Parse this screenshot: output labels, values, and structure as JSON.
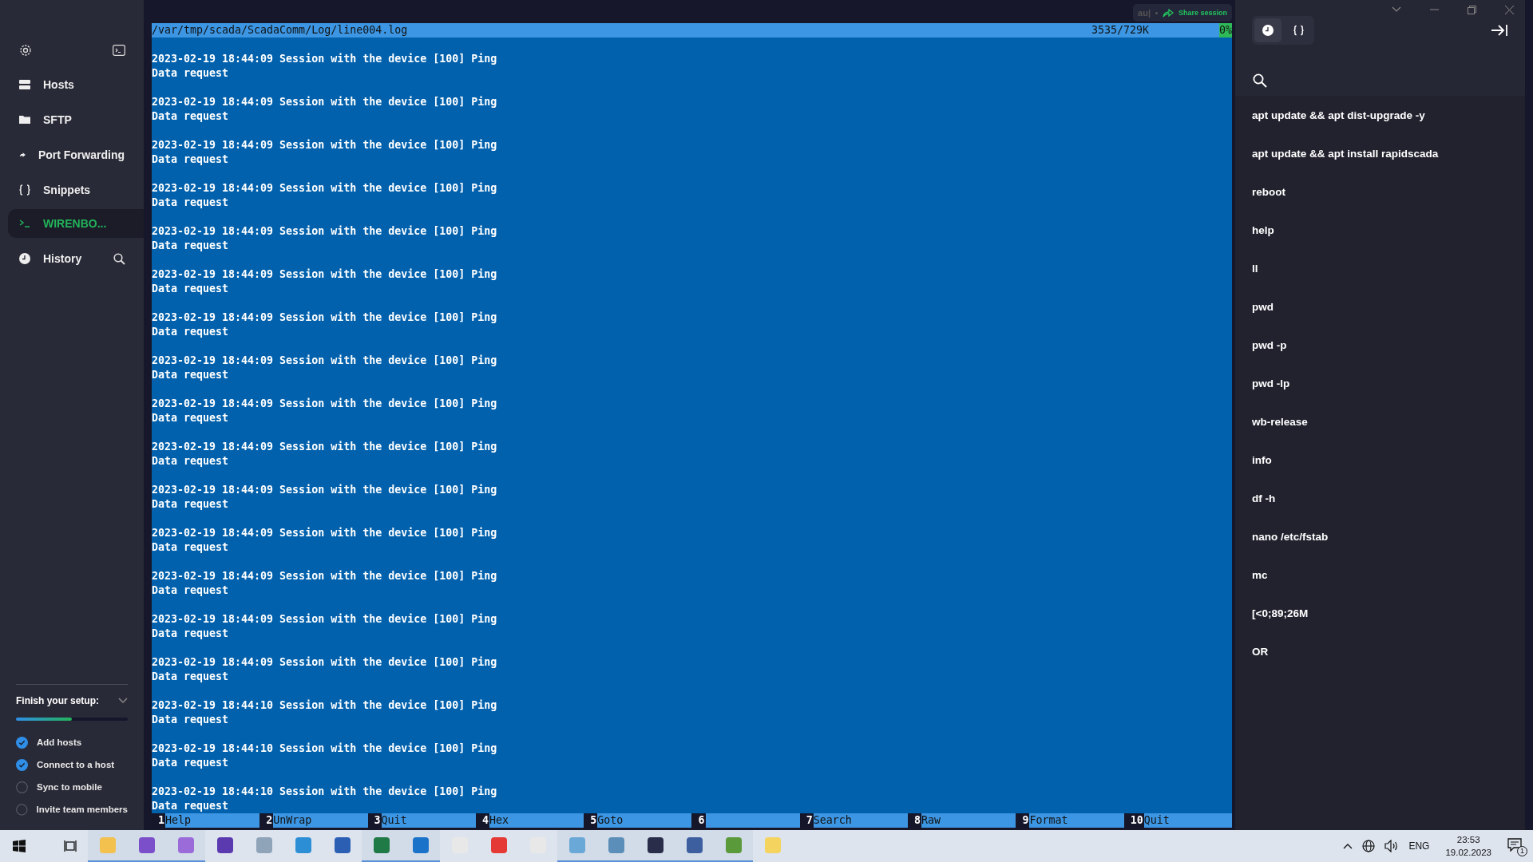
{
  "sidebar": {
    "nav": [
      {
        "label": "Hosts",
        "kind": "hosts",
        "selected": false
      },
      {
        "label": "SFTP",
        "kind": "folder",
        "selected": false
      },
      {
        "label": "Port Forwarding",
        "kind": "forward",
        "selected": false
      },
      {
        "label": "Snippets",
        "kind": "braces",
        "selected": false
      },
      {
        "label": "WIRENBO...",
        "kind": "terminal",
        "selected": true
      },
      {
        "label": "History",
        "kind": "clock",
        "selected": false
      }
    ],
    "setup": {
      "title": "Finish your setup:",
      "level": 0.5,
      "items": [
        {
          "label": "Add hosts",
          "checked": true
        },
        {
          "label": "Connect to a host",
          "checked": true
        },
        {
          "label": "Sync to mobile",
          "checked": false
        },
        {
          "label": "Invite team members",
          "checked": false
        }
      ]
    }
  },
  "share": {
    "typed": "au|",
    "label": "Share session"
  },
  "viewer": {
    "path": "/var/tmp/scada/ScadaComm/Log/line004.log",
    "position": "3535/729K",
    "percent": "0%",
    "entries": [
      {
        "line": "2023-02-19 18:44:09 Session with the device [100] Ping",
        "detail": "Data request"
      },
      {
        "line": "2023-02-19 18:44:09 Session with the device [100] Ping",
        "detail": "Data request"
      },
      {
        "line": "2023-02-19 18:44:09 Session with the device [100] Ping",
        "detail": "Data request"
      },
      {
        "line": "2023-02-19 18:44:09 Session with the device [100] Ping",
        "detail": "Data request"
      },
      {
        "line": "2023-02-19 18:44:09 Session with the device [100] Ping",
        "detail": "Data request"
      },
      {
        "line": "2023-02-19 18:44:09 Session with the device [100] Ping",
        "detail": "Data request"
      },
      {
        "line": "2023-02-19 18:44:09 Session with the device [100] Ping",
        "detail": "Data request"
      },
      {
        "line": "2023-02-19 18:44:09 Session with the device [100] Ping",
        "detail": "Data request"
      },
      {
        "line": "2023-02-19 18:44:09 Session with the device [100] Ping",
        "detail": "Data request"
      },
      {
        "line": "2023-02-19 18:44:09 Session with the device [100] Ping",
        "detail": "Data request"
      },
      {
        "line": "2023-02-19 18:44:09 Session with the device [100] Ping",
        "detail": "Data request"
      },
      {
        "line": "2023-02-19 18:44:09 Session with the device [100] Ping",
        "detail": "Data request"
      },
      {
        "line": "2023-02-19 18:44:09 Session with the device [100] Ping",
        "detail": "Data request"
      },
      {
        "line": "2023-02-19 18:44:09 Session with the device [100] Ping",
        "detail": "Data request"
      },
      {
        "line": "2023-02-19 18:44:09 Session with the device [100] Ping",
        "detail": "Data request"
      },
      {
        "line": "2023-02-19 18:44:10 Session with the device [100] Ping",
        "detail": "Data request"
      },
      {
        "line": "2023-02-19 18:44:10 Session with the device [100] Ping",
        "detail": "Data request"
      },
      {
        "line": "2023-02-19 18:44:10 Session with the device [100] Ping",
        "detail": "Data request"
      }
    ],
    "function_keys": [
      {
        "number": "1",
        "label": "Help"
      },
      {
        "number": "2",
        "label": "UnWrap"
      },
      {
        "number": "3",
        "label": "Quit"
      },
      {
        "number": "4",
        "label": "Hex"
      },
      {
        "number": "5",
        "label": "Goto"
      },
      {
        "number": "6"
      },
      {
        "number": "7",
        "label": "Search"
      },
      {
        "number": "8",
        "label": "Raw"
      },
      {
        "number": "9",
        "label": "Format"
      },
      {
        "number": "10",
        "label": "Quit"
      }
    ]
  },
  "panel": {
    "tabs": [
      {
        "kind": "clock",
        "selected": true
      },
      {
        "kind": "braces",
        "selected": false
      }
    ],
    "history": [
      "apt update && apt dist-upgrade -y",
      "apt update && apt install rapidscada",
      "reboot",
      "help",
      "ll",
      "pwd",
      "pwd -p",
      "pwd -lp",
      "wb-release",
      "info",
      "df -h",
      "nano /etc/fstab",
      "mc",
      "[<0;89;26M",
      "OR"
    ]
  },
  "taskbar": {
    "apps": [
      {
        "running": true
      },
      {
        "running": true
      },
      {
        "running": true
      },
      {
        "running": false
      },
      {
        "running": false
      },
      {
        "running": false
      },
      {
        "running": false
      },
      {
        "running": true
      },
      {
        "running": true
      },
      {
        "running": false
      },
      {
        "running": false
      },
      {
        "running": false
      },
      {
        "running": true
      },
      {
        "running": true
      },
      {
        "running": true
      },
      {
        "running": true
      },
      {
        "running": true
      },
      {
        "running": false
      }
    ],
    "language": "ENG",
    "time": "23:53",
    "date": "19.02.2023",
    "notifications": "1"
  }
}
